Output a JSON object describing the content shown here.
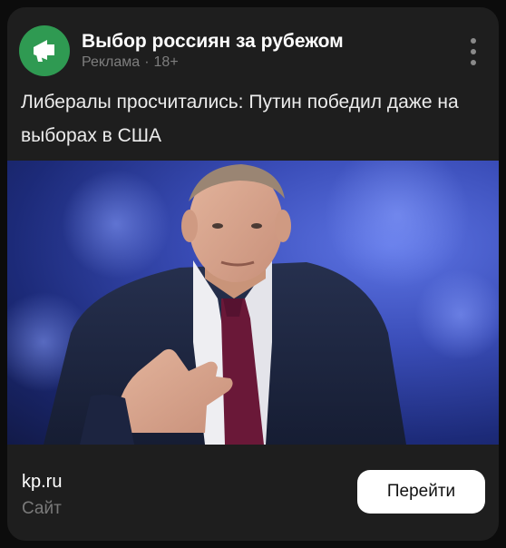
{
  "ad": {
    "channel_name": "Выбор россиян за рубежом",
    "label": "Реклама",
    "age_rating": "18+",
    "headline": "Либералы просчитались: Путин победил даже на выборах в США",
    "image_icon": "portrait-photo",
    "site_domain": "kp.ru",
    "site_type": "Сайт",
    "cta_label": "Перейти"
  },
  "icons": {
    "avatar": "megaphone-icon",
    "menu": "more-vertical-icon"
  },
  "colors": {
    "card_background": "#1e1e1e",
    "avatar_green": "#2f9a52",
    "button_background": "#ffffff"
  }
}
